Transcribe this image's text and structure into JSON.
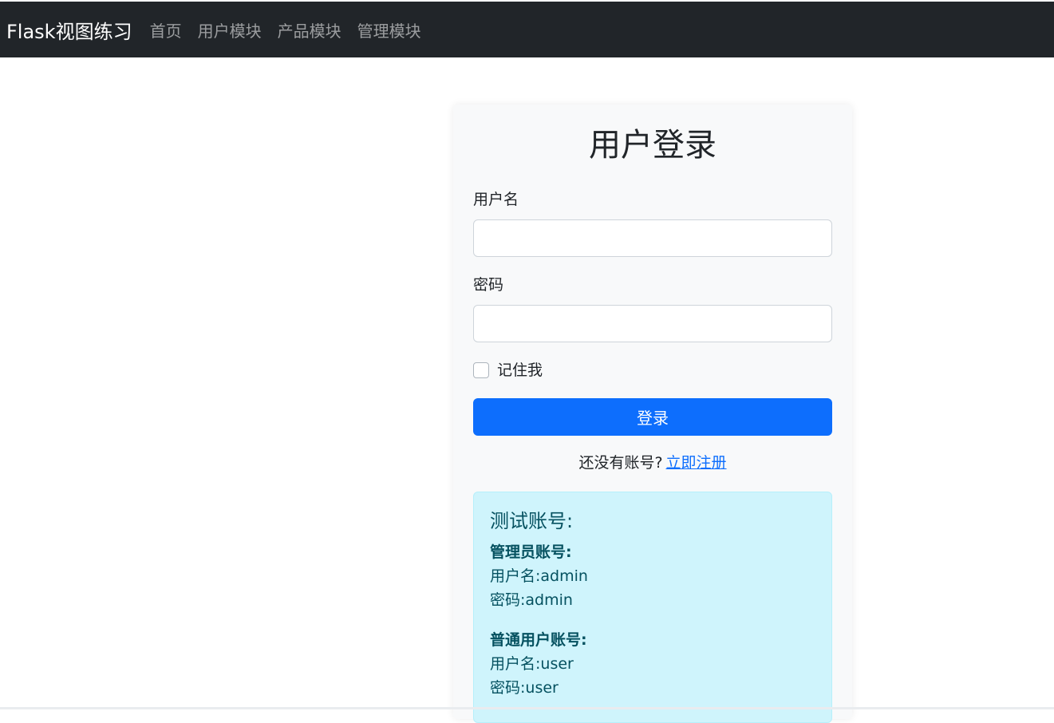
{
  "navbar": {
    "brand": "Flask视图练习",
    "links": [
      "首页",
      "用户模块",
      "产品模块",
      "管理模块"
    ]
  },
  "login": {
    "title": "用户登录",
    "username_label": "用户名",
    "username_value": "",
    "password_label": "密码",
    "password_value": "",
    "remember_label": "记住我",
    "remember_checked": false,
    "submit_label": "登录",
    "register_prompt": "还没有账号?",
    "register_link": "立即注册"
  },
  "test_accounts": {
    "title": "测试账号:",
    "admin_heading": "管理员账号:",
    "admin_username": "用户名:admin",
    "admin_password": "密码:admin",
    "user_heading": "普通用户账号:",
    "user_username": "用户名:user",
    "user_password": "密码:user"
  },
  "colors": {
    "navbar_bg": "#212529",
    "primary": "#0d6efd",
    "info_bg": "#cff4fc",
    "info_text": "#055160"
  }
}
